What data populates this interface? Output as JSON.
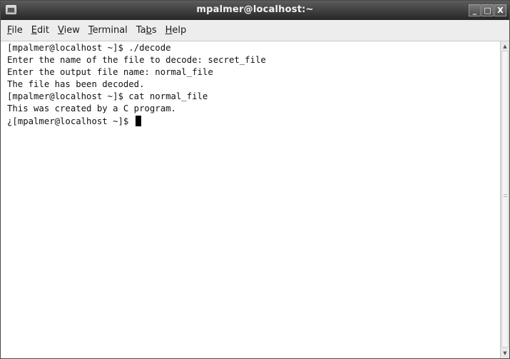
{
  "window": {
    "title": "mpalmer@localhost:~",
    "controls": {
      "minimize": "_",
      "maximize": "□",
      "close": "X"
    },
    "icon": "terminal-window-icon"
  },
  "menu": {
    "items": [
      {
        "label_pre": "",
        "mnemonic": "F",
        "label_post": "ile"
      },
      {
        "label_pre": "",
        "mnemonic": "E",
        "label_post": "dit"
      },
      {
        "label_pre": "",
        "mnemonic": "V",
        "label_post": "iew"
      },
      {
        "label_pre": "",
        "mnemonic": "T",
        "label_post": "erminal"
      },
      {
        "label_pre": "Ta",
        "mnemonic": "b",
        "label_post": "s"
      },
      {
        "label_pre": "",
        "mnemonic": "H",
        "label_post": "elp"
      }
    ]
  },
  "terminal": {
    "lines": [
      "[mpalmer@localhost ~]$ ./decode",
      "Enter the name of the file to decode: secret_file",
      "Enter the output file name: normal_file",
      "The file has been decoded.",
      "[mpalmer@localhost ~]$ cat normal_file",
      "This was created by a C program."
    ],
    "prompt": "¿[mpalmer@localhost ~]$ "
  },
  "scrollbar": {
    "up_arrow": "▲",
    "down_arrow": "▼"
  }
}
